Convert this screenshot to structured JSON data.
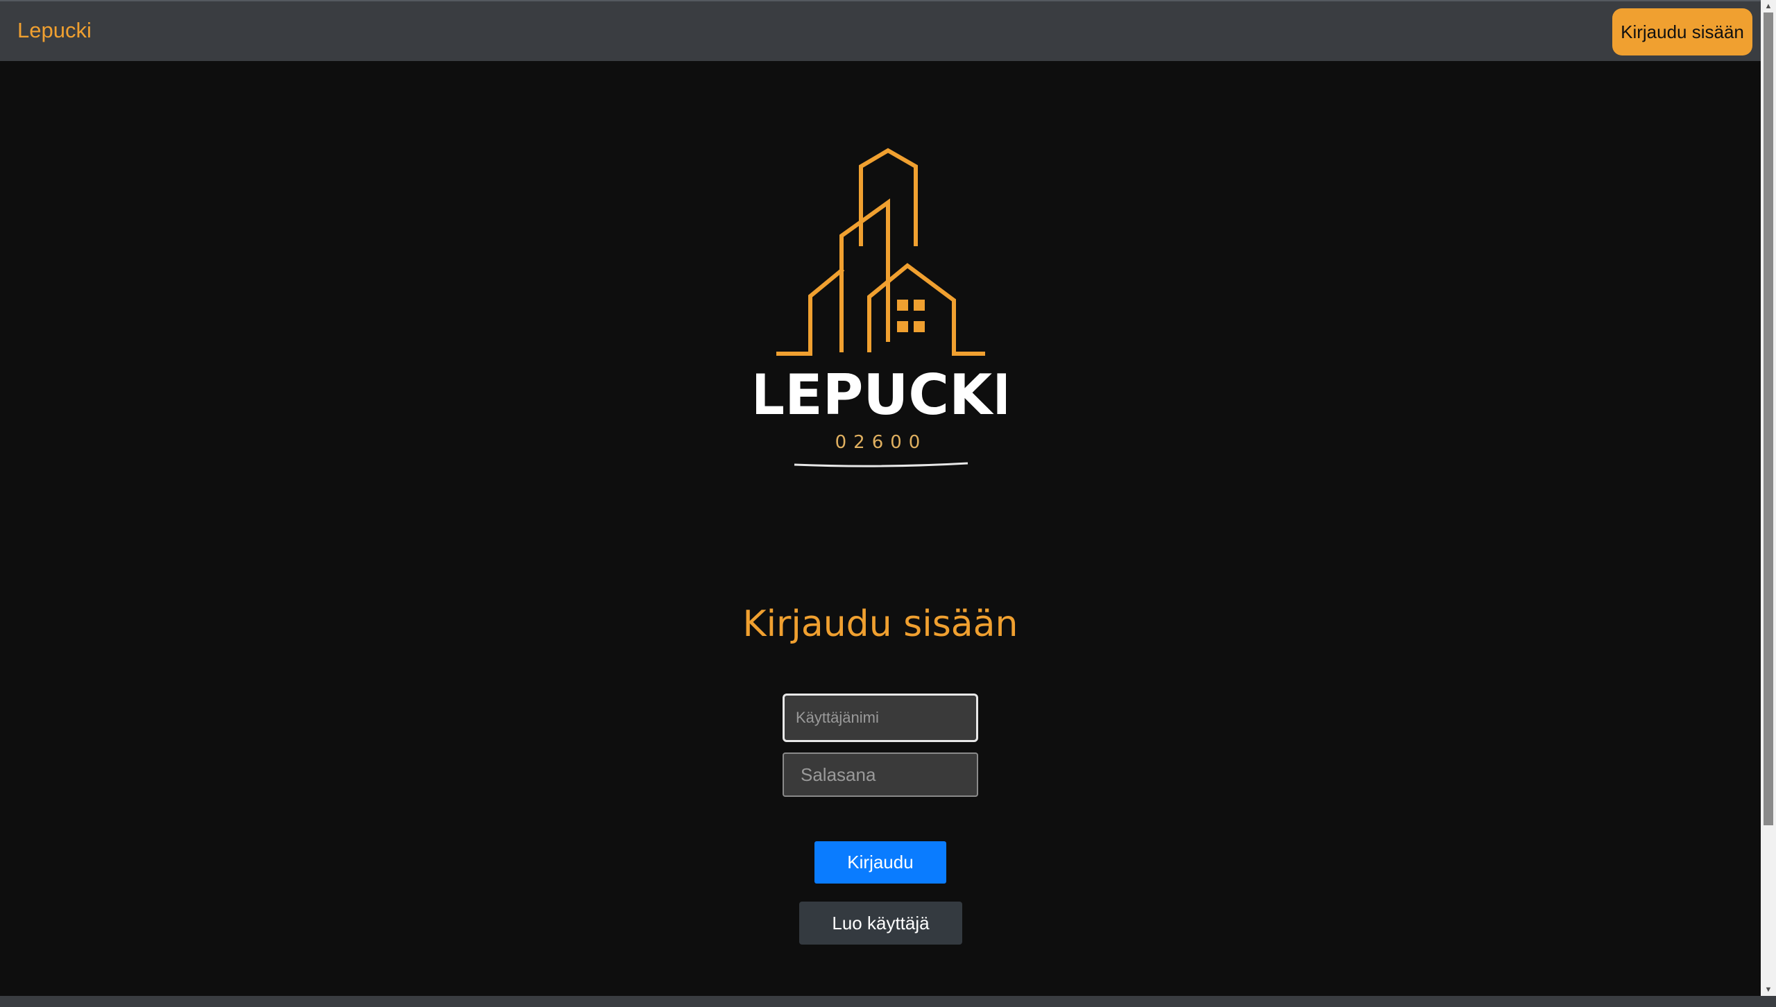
{
  "navbar": {
    "brand": "Lepucki",
    "login_button": "Kirjaudu sisään"
  },
  "logo": {
    "name": "LEPUCKI",
    "postal_code": "02600",
    "color": "#f0a030"
  },
  "form": {
    "title": "Kirjaudu sisään",
    "username_placeholder": "Käyttäjänimi",
    "password_placeholder": "Salasana",
    "submit_label": "Kirjaudu",
    "register_label": "Luo käyttäjä"
  },
  "colors": {
    "accent": "#f0a030",
    "primary_button": "#0a7cff",
    "secondary_button": "#343a40",
    "background": "#0e0e0e",
    "navbar": "#3a3d41"
  }
}
